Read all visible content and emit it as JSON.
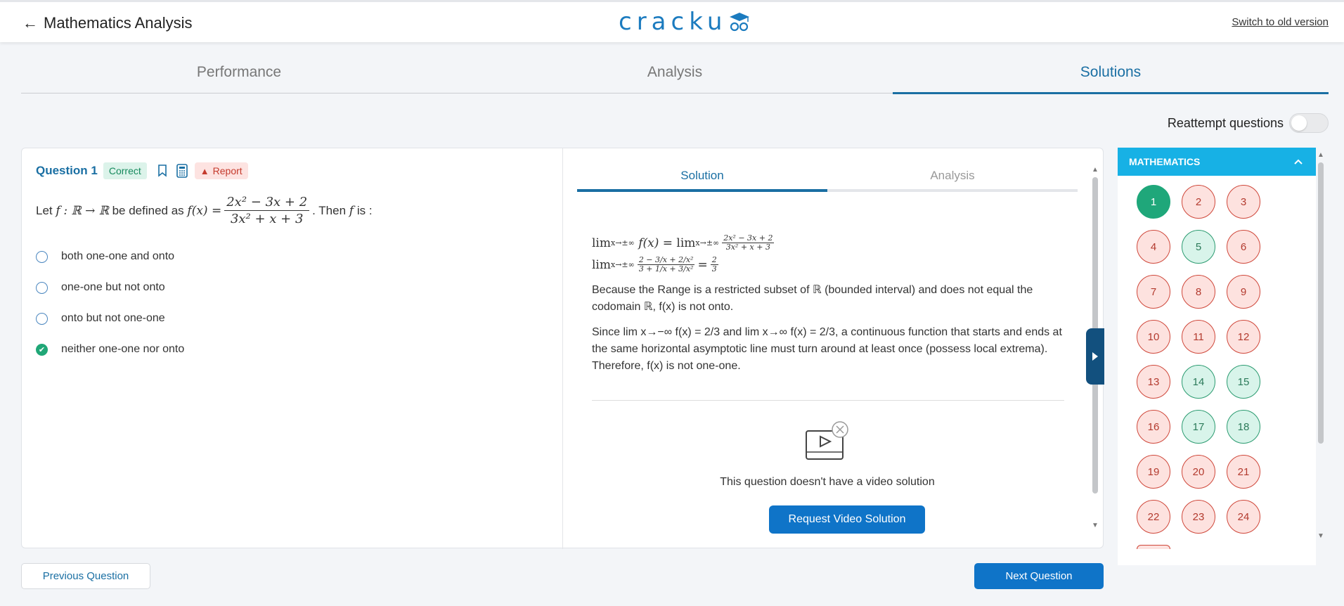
{
  "header": {
    "back_arrow": "←",
    "title": "Mathematics Analysis",
    "logo_text": "cracku",
    "switch_link": "Switch to old version"
  },
  "top_tabs": [
    {
      "label": "Performance",
      "active": false
    },
    {
      "label": "Analysis",
      "active": false
    },
    {
      "label": "Solutions",
      "active": true
    }
  ],
  "reattempt": {
    "label": "Reattempt questions",
    "enabled": false
  },
  "question": {
    "title": "Question 1",
    "status": "Correct",
    "report_label": "Report",
    "text_prefix": "Let",
    "text_f": "f",
    "text_domain": ": ℝ → ℝ",
    "text_mid": "be defined as",
    "text_fx": "f(x) =",
    "numerator": "2x² − 3x + 2",
    "denominator": "3x² + x + 3",
    "text_then": ". Then",
    "text_f2": "f",
    "text_is": "is :",
    "options": [
      {
        "label": "both one-one and onto",
        "selected": false
      },
      {
        "label": "one-one but not onto",
        "selected": false
      },
      {
        "label": "onto but not one-one",
        "selected": false
      },
      {
        "label": "neither one-one nor onto",
        "selected": true
      }
    ]
  },
  "solution": {
    "tabs": [
      {
        "label": "Solution",
        "active": true
      },
      {
        "label": "Analysis",
        "active": false
      }
    ],
    "line1_left": "lim",
    "line1_sub": "x→±∞",
    "line1_fx": "f(x) =",
    "line1_lim2": "lim",
    "line1_sub2": "x→±∞",
    "line1_num": "2x² − 3x + 2",
    "line1_den": "3x² + x + 3",
    "line2_lim": "lim",
    "line2_sub": "x→±∞",
    "line2_num": "2 − 3/x + 2/x²",
    "line2_den": "3 + 1/x + 3/x²",
    "line2_eq": "=",
    "line2_rnum": "2",
    "line2_rden": "3",
    "para1": "Because the Range is a restricted subset of ℝ (bounded interval) and does not equal the codomain ℝ, f(x) is not onto.",
    "para2": "Since lim x→−∞ f(x) = 2/3 and lim x→∞ f(x) = 2/3, a continuous function that starts and ends at the same horizontal asymptotic line must turn around at least once (possess local extrema). Therefore, f(x) is not one-one.",
    "no_video": "This question doesn't have a video solution",
    "request_button": "Request Video Solution"
  },
  "palette": {
    "section": "MATHEMATICS",
    "questions": [
      {
        "n": "1",
        "state": "current"
      },
      {
        "n": "2",
        "state": "wrong"
      },
      {
        "n": "3",
        "state": "wrong"
      },
      {
        "n": "4",
        "state": "wrong"
      },
      {
        "n": "5",
        "state": "right"
      },
      {
        "n": "6",
        "state": "wrong"
      },
      {
        "n": "7",
        "state": "wrong"
      },
      {
        "n": "8",
        "state": "wrong"
      },
      {
        "n": "9",
        "state": "wrong"
      },
      {
        "n": "10",
        "state": "wrong"
      },
      {
        "n": "11",
        "state": "wrong"
      },
      {
        "n": "12",
        "state": "wrong"
      },
      {
        "n": "13",
        "state": "wrong"
      },
      {
        "n": "14",
        "state": "right"
      },
      {
        "n": "15",
        "state": "right"
      },
      {
        "n": "16",
        "state": "wrong"
      },
      {
        "n": "17",
        "state": "right"
      },
      {
        "n": "18",
        "state": "right"
      },
      {
        "n": "19",
        "state": "wrong"
      },
      {
        "n": "20",
        "state": "wrong"
      },
      {
        "n": "21",
        "state": "wrong"
      },
      {
        "n": "22",
        "state": "wrong"
      },
      {
        "n": "23",
        "state": "wrong"
      },
      {
        "n": "24",
        "state": "wrong"
      }
    ]
  },
  "nav": {
    "previous": "Previous Question",
    "next": "Next Question"
  },
  "colors": {
    "brand_blue": "#1a6fa3",
    "primary_button": "#0f74c8",
    "palette_header": "#17b1e5",
    "correct_green": "#1fa77a",
    "wrong_red": "#cf473a"
  }
}
